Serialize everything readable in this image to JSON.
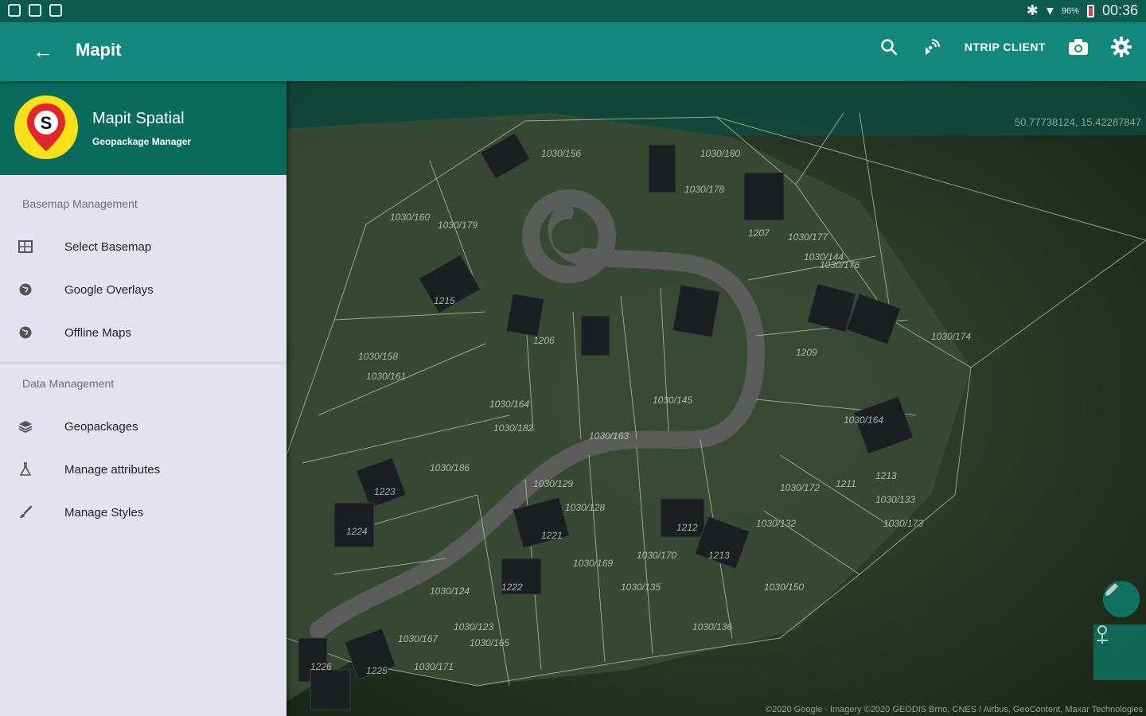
{
  "status_bar": {
    "battery": "96%",
    "time": "00:36"
  },
  "toolbar": {
    "title": "Mapit",
    "ntrip_label": "NTRIP CLIENT"
  },
  "drawer": {
    "app_name": "Mapit Spatial",
    "app_subtitle": "Geopackage Manager",
    "sections": [
      {
        "title": "Basemap Management",
        "items": [
          {
            "label": "Select Basemap",
            "icon": "map-icon"
          },
          {
            "label": "Google Overlays",
            "icon": "globe-icon"
          },
          {
            "label": "Offline Maps",
            "icon": "globe-icon"
          }
        ]
      },
      {
        "title": "Data Management",
        "items": [
          {
            "label": "Geopackages",
            "icon": "layers-icon"
          },
          {
            "label": "Manage attributes",
            "icon": "flask-icon"
          },
          {
            "label": "Manage Styles",
            "icon": "brush-icon"
          }
        ]
      }
    ]
  },
  "map": {
    "coordinates": "50.77738124, 15.42287847",
    "attribution": "©2020 Google · Imagery ©2020 GEODIS Brno, CNES / Airbus, GeoContent, Maxar Technologies",
    "parcel_labels": [
      "1030/156",
      "1030/160",
      "1030/179",
      "1030/180",
      "1030/178",
      "1207",
      "1030/177",
      "1030/144",
      "1030/176",
      "1215",
      "1030/158",
      "1030/161",
      "1206",
      "1030/164",
      "1030/182",
      "1030/163",
      "1030/145",
      "1209",
      "1030/164",
      "1030/174",
      "1213",
      "1030/186",
      "1030/129",
      "1030/128",
      "1030/172",
      "1211",
      "1030/133",
      "1223",
      "1224",
      "1221",
      "1030/170",
      "1030/169",
      "1212",
      "1213",
      "1030/132",
      "1030/150",
      "1222",
      "1030/124",
      "1030/123",
      "1030/167",
      "1030/165",
      "1225",
      "1226",
      "1030/171",
      "1030/136",
      "1030/135",
      "1030/173"
    ],
    "colors": {
      "road": "#5a5d5a",
      "parcel_line": "#b8c4b0",
      "rooftop": "#1c1f22"
    }
  }
}
